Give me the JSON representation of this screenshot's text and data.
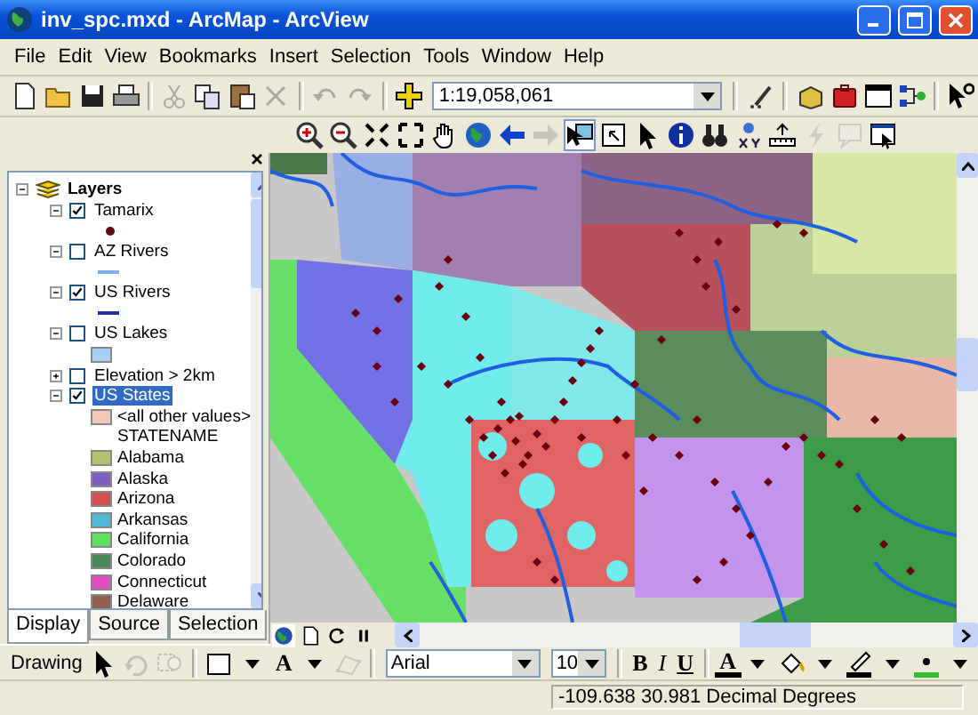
{
  "window": {
    "title": "inv_spc.mxd - ArcMap - ArcView"
  },
  "menu": [
    "File",
    "Edit",
    "View",
    "Bookmarks",
    "Insert",
    "Selection",
    "Tools",
    "Window",
    "Help"
  ],
  "standard_toolbar": [
    {
      "kind": "new",
      "disabled": false
    },
    {
      "kind": "open",
      "disabled": false
    },
    {
      "kind": "save",
      "disabled": false
    },
    {
      "kind": "print",
      "disabled": false
    },
    {
      "kind": "separator"
    },
    {
      "kind": "cut",
      "disabled": true
    },
    {
      "kind": "copy",
      "disabled": false
    },
    {
      "kind": "paste",
      "disabled": false
    },
    {
      "kind": "delete",
      "disabled": true
    },
    {
      "kind": "separator"
    },
    {
      "kind": "undo",
      "disabled": true
    },
    {
      "kind": "redo",
      "disabled": true
    },
    {
      "kind": "separator"
    },
    {
      "kind": "add-data",
      "disabled": false
    },
    {
      "kind": "scale",
      "value": "1:19,058,061"
    },
    {
      "kind": "separator"
    },
    {
      "kind": "editor",
      "disabled": false
    },
    {
      "kind": "separator"
    },
    {
      "kind": "catalog",
      "disabled": false
    },
    {
      "kind": "toolbox",
      "disabled": false
    },
    {
      "kind": "window",
      "disabled": false
    },
    {
      "kind": "model",
      "disabled": false
    },
    {
      "kind": "separator"
    },
    {
      "kind": "help",
      "disabled": false
    }
  ],
  "tools_toolbar": [
    {
      "kind": "zoom-in",
      "disabled": false
    },
    {
      "kind": "zoom-out",
      "disabled": false
    },
    {
      "kind": "fixed-zoom-in",
      "disabled": false
    },
    {
      "kind": "fixed-zoom-out",
      "disabled": false
    },
    {
      "kind": "pan",
      "disabled": false
    },
    {
      "kind": "full-extent",
      "disabled": false
    },
    {
      "kind": "back",
      "disabled": false
    },
    {
      "kind": "forward",
      "disabled": true
    },
    {
      "kind": "select-features",
      "selected": true,
      "disabled": false
    },
    {
      "kind": "select-box",
      "disabled": false
    },
    {
      "kind": "pointer",
      "disabled": false
    },
    {
      "kind": "identify",
      "disabled": false
    },
    {
      "kind": "find",
      "disabled": false
    },
    {
      "kind": "goto-xy",
      "disabled": false
    },
    {
      "kind": "measure",
      "disabled": false
    },
    {
      "kind": "hyperlink",
      "disabled": true
    },
    {
      "kind": "popup",
      "disabled": true
    },
    {
      "kind": "map-tips",
      "disabled": false
    }
  ],
  "toc": {
    "name": "Layers",
    "expanded": true,
    "children": [
      {
        "name": "Tamarix",
        "checked": true,
        "expanded": true,
        "selected": false,
        "legend": [
          {
            "kind": "point",
            "color": "#5a0a10"
          }
        ]
      },
      {
        "name": "AZ Rivers",
        "checked": false,
        "expanded": true,
        "selected": false,
        "legend": [
          {
            "kind": "line",
            "color": "#80b0e8"
          }
        ]
      },
      {
        "name": "US Rivers",
        "checked": true,
        "expanded": true,
        "selected": false,
        "legend": [
          {
            "kind": "line",
            "color": "#1c30b0"
          }
        ]
      },
      {
        "name": "US Lakes",
        "checked": false,
        "expanded": true,
        "selected": false,
        "legend": [
          {
            "kind": "fill",
            "color": "#a8d0f4"
          }
        ]
      },
      {
        "name": "Elevation > 2km",
        "checked": false,
        "expanded": false,
        "selected": false
      },
      {
        "name": "US States",
        "checked": true,
        "expanded": true,
        "selected": true,
        "legend": [
          {
            "kind": "fill",
            "color": "#f0c8b8",
            "label": "<all other values>"
          },
          {
            "kind": "heading",
            "label": "STATENAME"
          },
          {
            "kind": "fill",
            "color": "#b4c070",
            "label": "Alabama"
          },
          {
            "kind": "fill",
            "color": "#8060c0",
            "label": "Alaska"
          },
          {
            "kind": "fill",
            "color": "#d05050",
            "label": "Arizona"
          },
          {
            "kind": "fill",
            "color": "#50b8d0",
            "label": "Arkansas"
          },
          {
            "kind": "fill",
            "color": "#60e060",
            "label": "California"
          },
          {
            "kind": "fill",
            "color": "#4a8a58",
            "label": "Colorado"
          },
          {
            "kind": "fill",
            "color": "#e050c0",
            "label": "Connecticut"
          },
          {
            "kind": "fill",
            "color": "#906050",
            "label": "Delaware"
          }
        ]
      }
    ]
  },
  "toc_tabs": [
    {
      "label": "Display",
      "selected": true
    },
    {
      "label": "Source",
      "selected": false
    },
    {
      "label": "Selection",
      "selected": false
    }
  ],
  "view_buttons": [
    {
      "kind": "data-view",
      "selected": true
    },
    {
      "kind": "layout-view",
      "selected": false
    },
    {
      "kind": "refresh",
      "selected": false
    },
    {
      "kind": "pause",
      "selected": false
    }
  ],
  "drawing_toolbar": [
    {
      "kind": "menu",
      "label": "Drawing",
      "disabled": false
    },
    {
      "kind": "pointer",
      "disabled": false
    },
    {
      "kind": "rotate",
      "disabled": true
    },
    {
      "kind": "zoom-selected",
      "disabled": true
    },
    {
      "kind": "separator"
    },
    {
      "kind": "rectangle",
      "disabled": false
    },
    {
      "kind": "dropdown",
      "disabled": false
    },
    {
      "kind": "text",
      "label": "A",
      "disabled": false
    },
    {
      "kind": "dropdown",
      "disabled": false
    },
    {
      "kind": "vertices",
      "disabled": true
    },
    {
      "kind": "separator"
    },
    {
      "kind": "font",
      "value": "Arial",
      "disabled": false
    },
    {
      "kind": "size",
      "value": "10",
      "disabled": false
    },
    {
      "kind": "separator"
    },
    {
      "kind": "bold",
      "label": "B",
      "disabled": false
    },
    {
      "kind": "italic",
      "label": "I",
      "disabled": false
    },
    {
      "kind": "underline",
      "label": "U",
      "disabled": false
    },
    {
      "kind": "separator"
    },
    {
      "kind": "font-color",
      "label": "A",
      "color": "#000000",
      "disabled": false
    },
    {
      "kind": "dropdown",
      "disabled": false
    },
    {
      "kind": "fill-color",
      "disabled": false
    },
    {
      "kind": "dropdown",
      "disabled": false
    },
    {
      "kind": "line-color",
      "color": "#000000",
      "disabled": false
    },
    {
      "kind": "dropdown",
      "disabled": false
    },
    {
      "kind": "marker-color",
      "color": "#30c030",
      "disabled": false
    },
    {
      "kind": "dropdown",
      "disabled": false
    }
  ],
  "status_bar": {
    "coordinates": "-109.638  30.981 Decimal Degrees"
  }
}
